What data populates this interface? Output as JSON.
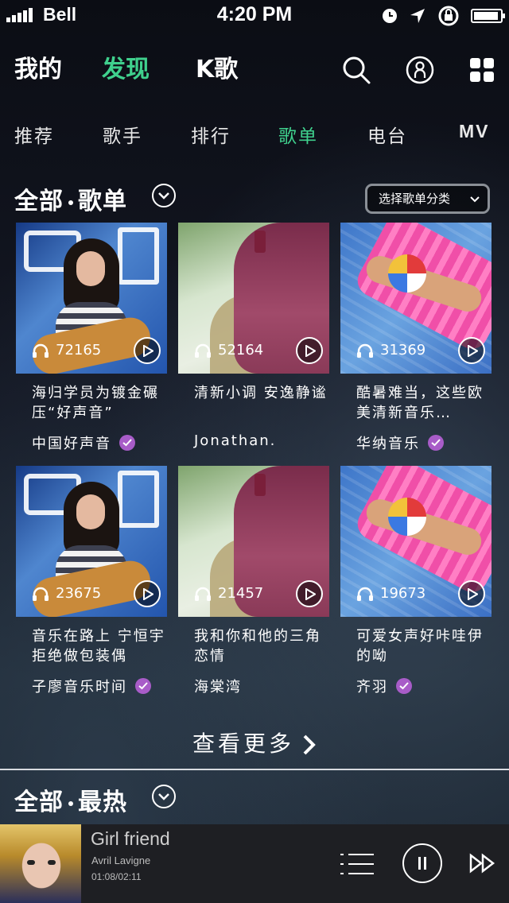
{
  "status_bar": {
    "carrier": "Bell",
    "time": "4:20 PM"
  },
  "top_nav": {
    "tabs": [
      {
        "label": "我的"
      },
      {
        "label": "发现"
      },
      {
        "label": "K歌"
      }
    ],
    "active": "发现"
  },
  "sub_tabs": {
    "items": [
      {
        "label": "推荐"
      },
      {
        "label": "歌手"
      },
      {
        "label": "排行"
      },
      {
        "label": "歌单"
      },
      {
        "label": "电台"
      },
      {
        "label": "MV"
      }
    ],
    "active": "歌单"
  },
  "playlist_section": {
    "title_a": "全部",
    "title_b": "歌单",
    "category_select": "选择歌单分类",
    "cards": [
      {
        "plays": "72165",
        "title": "海归学员为镀金碾压“好声音”",
        "author": "中国好声音",
        "verified": true
      },
      {
        "plays": "52164",
        "title": "清新小调 安逸静谧",
        "author": "Jonathan.",
        "verified": false
      },
      {
        "plays": "31369",
        "title": "酷暑难当，这些欧美清新音乐…",
        "author": "华纳音乐",
        "verified": true
      },
      {
        "plays": "23675",
        "title": "音乐在路上 宁恒宇拒绝做包装偶",
        "author": "子廖音乐时间",
        "verified": true
      },
      {
        "plays": "21457",
        "title": "我和你和他的三角恋情",
        "author": "海棠湾",
        "verified": false
      },
      {
        "plays": "19673",
        "title": "可爱女声好咔哇伊的呦",
        "author": "齐羽",
        "verified": true
      }
    ],
    "more_label": "查看更多"
  },
  "hot_section": {
    "title_a": "全部",
    "title_b": "最热"
  },
  "player": {
    "song": "Girl friend",
    "artist": "Avril Lavigne",
    "progress": "01:08/02:11"
  },
  "colors": {
    "accent": "#3fd08d",
    "verified_badge": "#a85cc8"
  }
}
